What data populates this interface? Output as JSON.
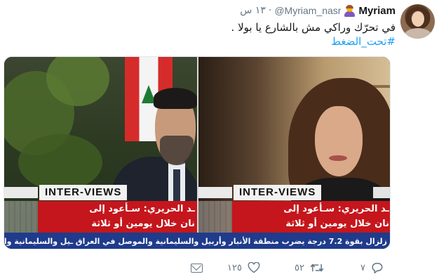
{
  "tweet": {
    "display_name": "Myriam",
    "user_emoji_icon": "woman-emoji-icon",
    "handle": "@Myriam_nasr",
    "separator": "·",
    "time": "١٣ س",
    "text": "في تحرّك وراكي مش بالشارع يا بولا .",
    "hashtag": "#تحت_الضغط"
  },
  "media": {
    "left_panel": {
      "ribbon": "INTER-VIEWS",
      "caption_line1": "ـد الحريري: سـأعود إلى",
      "caption_line2": "نان خلال يومين أو ثلاثة"
    },
    "right_panel": {
      "ribbon": "INTER-VIEWS",
      "caption_line1": "ـد الحريري: سـأعود إلى",
      "caption_line2": "نان خلال يومين أو ثلاثة"
    },
    "ticker": "زلزال بقوة 7.2 درجة يضرب منطقة الأنبار وأربيل والسليمانية والموصل في العراق ـيل والسليمانية والموصل في العراق"
  },
  "actions": {
    "reply_icon": "reply-icon",
    "reply_count": "٧",
    "retweet_icon": "retweet-icon",
    "retweet_count": "٥٢",
    "like_icon": "heart-icon",
    "like_count": "١٢٥",
    "message_icon": "mail-icon"
  },
  "colors": {
    "link_blue": "#1da1f2",
    "muted_gray": "#657786",
    "caption_red": "#c4161c",
    "ticker_blue": "#1f3b8c"
  }
}
